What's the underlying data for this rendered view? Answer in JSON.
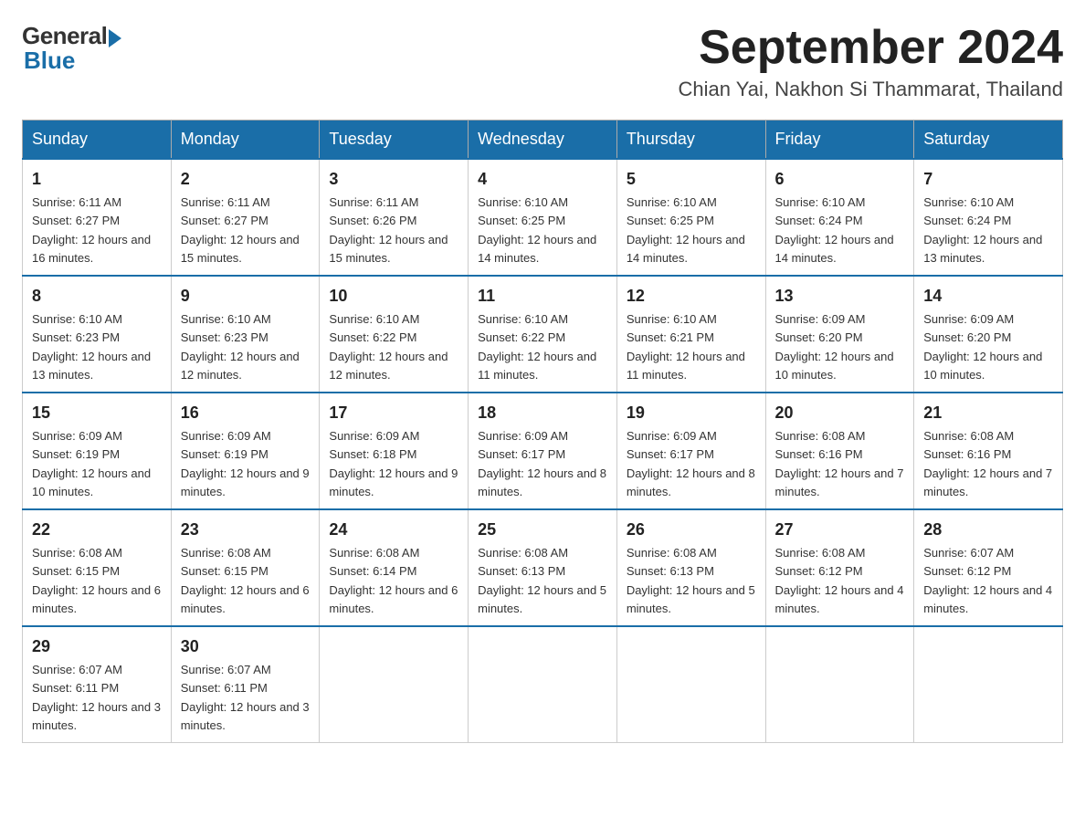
{
  "logo": {
    "general": "General",
    "blue": "Blue"
  },
  "title": {
    "month": "September 2024",
    "location": "Chian Yai, Nakhon Si Thammarat, Thailand"
  },
  "headers": [
    "Sunday",
    "Monday",
    "Tuesday",
    "Wednesday",
    "Thursday",
    "Friday",
    "Saturday"
  ],
  "weeks": [
    [
      {
        "day": "1",
        "sunrise": "6:11 AM",
        "sunset": "6:27 PM",
        "daylight": "12 hours and 16 minutes."
      },
      {
        "day": "2",
        "sunrise": "6:11 AM",
        "sunset": "6:27 PM",
        "daylight": "12 hours and 15 minutes."
      },
      {
        "day": "3",
        "sunrise": "6:11 AM",
        "sunset": "6:26 PM",
        "daylight": "12 hours and 15 minutes."
      },
      {
        "day": "4",
        "sunrise": "6:10 AM",
        "sunset": "6:25 PM",
        "daylight": "12 hours and 14 minutes."
      },
      {
        "day": "5",
        "sunrise": "6:10 AM",
        "sunset": "6:25 PM",
        "daylight": "12 hours and 14 minutes."
      },
      {
        "day": "6",
        "sunrise": "6:10 AM",
        "sunset": "6:24 PM",
        "daylight": "12 hours and 14 minutes."
      },
      {
        "day": "7",
        "sunrise": "6:10 AM",
        "sunset": "6:24 PM",
        "daylight": "12 hours and 13 minutes."
      }
    ],
    [
      {
        "day": "8",
        "sunrise": "6:10 AM",
        "sunset": "6:23 PM",
        "daylight": "12 hours and 13 minutes."
      },
      {
        "day": "9",
        "sunrise": "6:10 AM",
        "sunset": "6:23 PM",
        "daylight": "12 hours and 12 minutes."
      },
      {
        "day": "10",
        "sunrise": "6:10 AM",
        "sunset": "6:22 PM",
        "daylight": "12 hours and 12 minutes."
      },
      {
        "day": "11",
        "sunrise": "6:10 AM",
        "sunset": "6:22 PM",
        "daylight": "12 hours and 11 minutes."
      },
      {
        "day": "12",
        "sunrise": "6:10 AM",
        "sunset": "6:21 PM",
        "daylight": "12 hours and 11 minutes."
      },
      {
        "day": "13",
        "sunrise": "6:09 AM",
        "sunset": "6:20 PM",
        "daylight": "12 hours and 10 minutes."
      },
      {
        "day": "14",
        "sunrise": "6:09 AM",
        "sunset": "6:20 PM",
        "daylight": "12 hours and 10 minutes."
      }
    ],
    [
      {
        "day": "15",
        "sunrise": "6:09 AM",
        "sunset": "6:19 PM",
        "daylight": "12 hours and 10 minutes."
      },
      {
        "day": "16",
        "sunrise": "6:09 AM",
        "sunset": "6:19 PM",
        "daylight": "12 hours and 9 minutes."
      },
      {
        "day": "17",
        "sunrise": "6:09 AM",
        "sunset": "6:18 PM",
        "daylight": "12 hours and 9 minutes."
      },
      {
        "day": "18",
        "sunrise": "6:09 AM",
        "sunset": "6:17 PM",
        "daylight": "12 hours and 8 minutes."
      },
      {
        "day": "19",
        "sunrise": "6:09 AM",
        "sunset": "6:17 PM",
        "daylight": "12 hours and 8 minutes."
      },
      {
        "day": "20",
        "sunrise": "6:08 AM",
        "sunset": "6:16 PM",
        "daylight": "12 hours and 7 minutes."
      },
      {
        "day": "21",
        "sunrise": "6:08 AM",
        "sunset": "6:16 PM",
        "daylight": "12 hours and 7 minutes."
      }
    ],
    [
      {
        "day": "22",
        "sunrise": "6:08 AM",
        "sunset": "6:15 PM",
        "daylight": "12 hours and 6 minutes."
      },
      {
        "day": "23",
        "sunrise": "6:08 AM",
        "sunset": "6:15 PM",
        "daylight": "12 hours and 6 minutes."
      },
      {
        "day": "24",
        "sunrise": "6:08 AM",
        "sunset": "6:14 PM",
        "daylight": "12 hours and 6 minutes."
      },
      {
        "day": "25",
        "sunrise": "6:08 AM",
        "sunset": "6:13 PM",
        "daylight": "12 hours and 5 minutes."
      },
      {
        "day": "26",
        "sunrise": "6:08 AM",
        "sunset": "6:13 PM",
        "daylight": "12 hours and 5 minutes."
      },
      {
        "day": "27",
        "sunrise": "6:08 AM",
        "sunset": "6:12 PM",
        "daylight": "12 hours and 4 minutes."
      },
      {
        "day": "28",
        "sunrise": "6:07 AM",
        "sunset": "6:12 PM",
        "daylight": "12 hours and 4 minutes."
      }
    ],
    [
      {
        "day": "29",
        "sunrise": "6:07 AM",
        "sunset": "6:11 PM",
        "daylight": "12 hours and 3 minutes."
      },
      {
        "day": "30",
        "sunrise": "6:07 AM",
        "sunset": "6:11 PM",
        "daylight": "12 hours and 3 minutes."
      },
      null,
      null,
      null,
      null,
      null
    ]
  ]
}
